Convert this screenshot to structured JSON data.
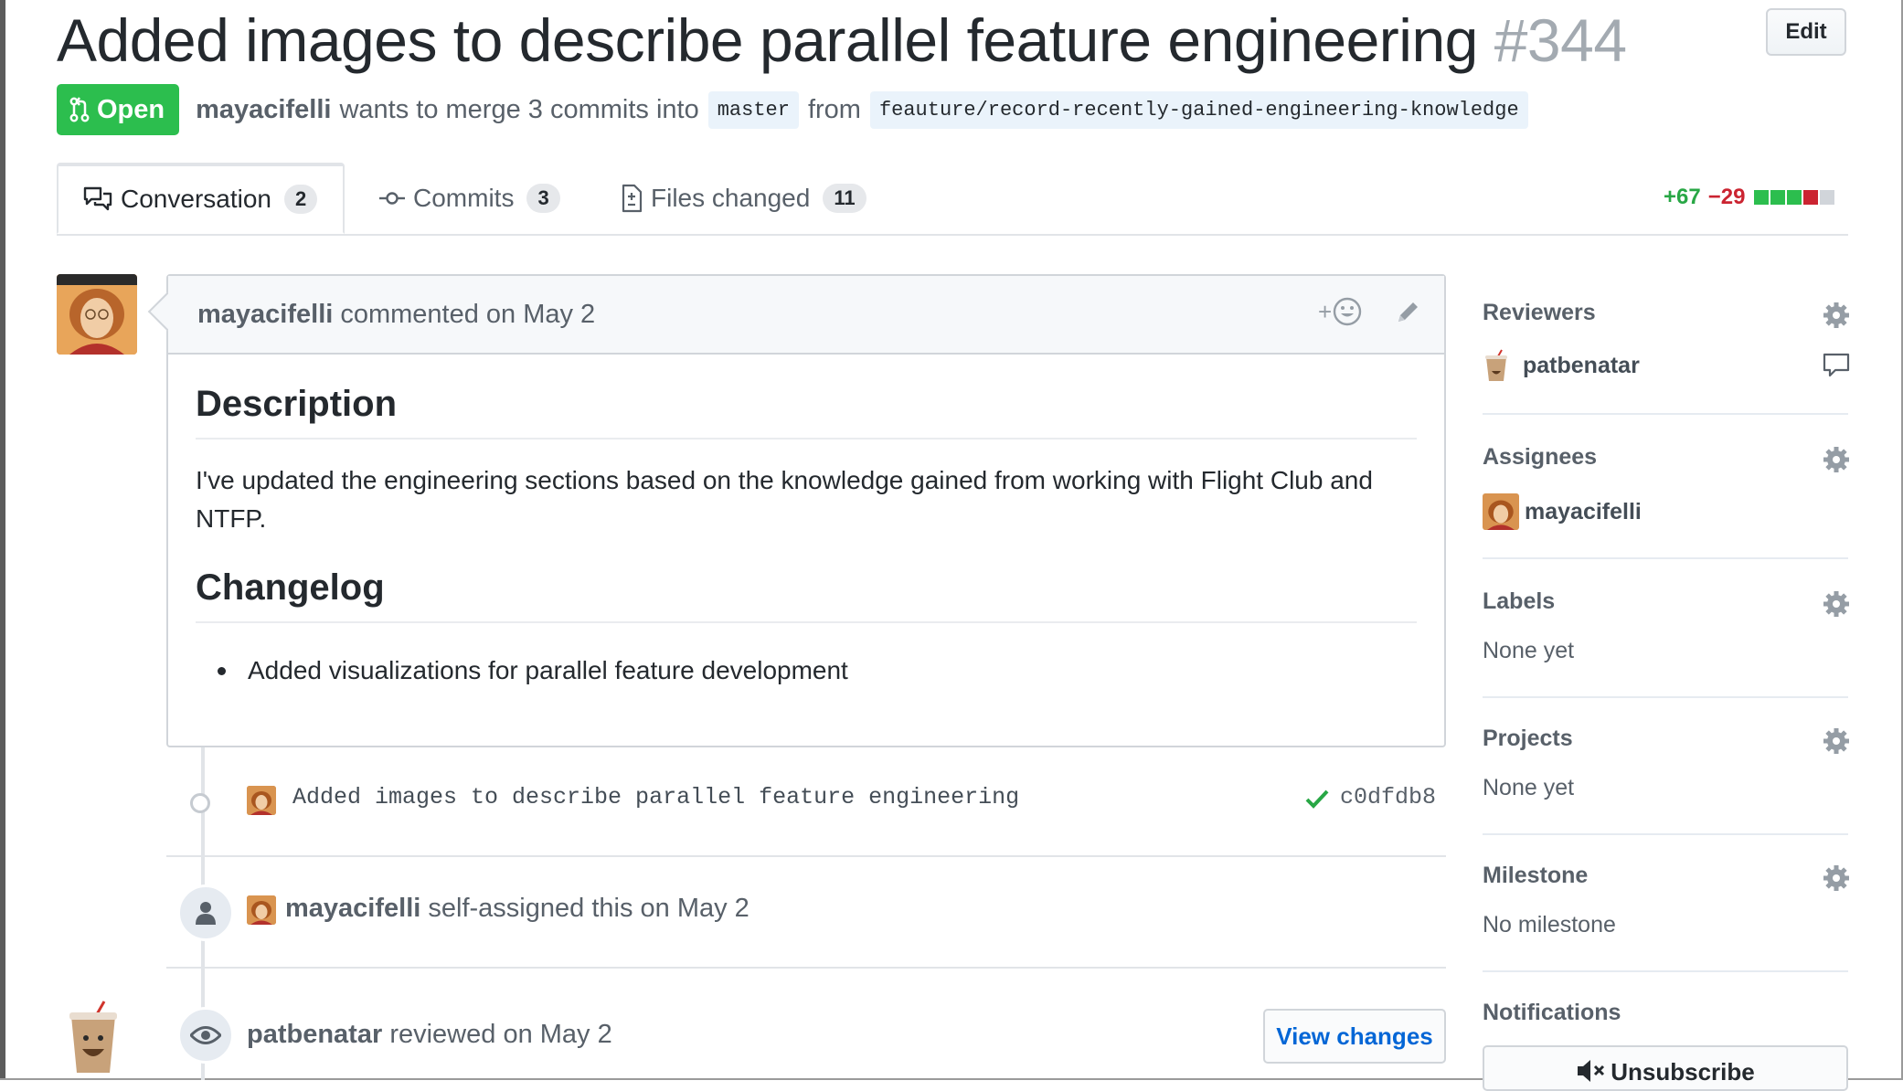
{
  "pr": {
    "title": "Added images to describe parallel feature engineering",
    "number": "#344",
    "edit_label": "Edit",
    "state": "Open",
    "author": "mayacifelli",
    "merge_text": "wants to merge 3 commits into",
    "base_branch": "master",
    "from_text": "from",
    "head_branch": "feauture/record-recently-gained-engineering-knowledge"
  },
  "tabs": [
    {
      "label": "Conversation",
      "count": "2"
    },
    {
      "label": "Commits",
      "count": "3"
    },
    {
      "label": "Files changed",
      "count": "11"
    }
  ],
  "diffstat": {
    "additions": "+67",
    "deletions": "−29"
  },
  "comment": {
    "author": "mayacifelli",
    "action": "commented on May 2",
    "reaction_label": "+",
    "heading1": "Description",
    "paragraph": "I've updated the engineering sections based on the knowledge gained from working with Flight Club and NTFP.",
    "heading2": "Changelog",
    "list_item": "Added visualizations for parallel feature development"
  },
  "timeline": {
    "commit_message": "Added images to describe parallel feature engineering",
    "commit_sha": "c0dfdb8",
    "assign_author": "mayacifelli",
    "assign_text": "self-assigned this on May 2",
    "review_author": "patbenatar",
    "review_text": "reviewed on May 2",
    "view_changes_label": "View changes"
  },
  "sidebar": {
    "reviewers_title": "Reviewers",
    "reviewer": "patbenatar",
    "assignees_title": "Assignees",
    "assignee": "mayacifelli",
    "labels_title": "Labels",
    "labels_value": "None yet",
    "projects_title": "Projects",
    "projects_value": "None yet",
    "milestone_title": "Milestone",
    "milestone_value": "No milestone",
    "notifications_title": "Notifications",
    "unsubscribe_label": "Unsubscribe"
  },
  "colors": {
    "open_green": "#2cbe4e",
    "add_green": "#28a745",
    "del_red": "#cb2431",
    "link_blue": "#0366d6"
  }
}
